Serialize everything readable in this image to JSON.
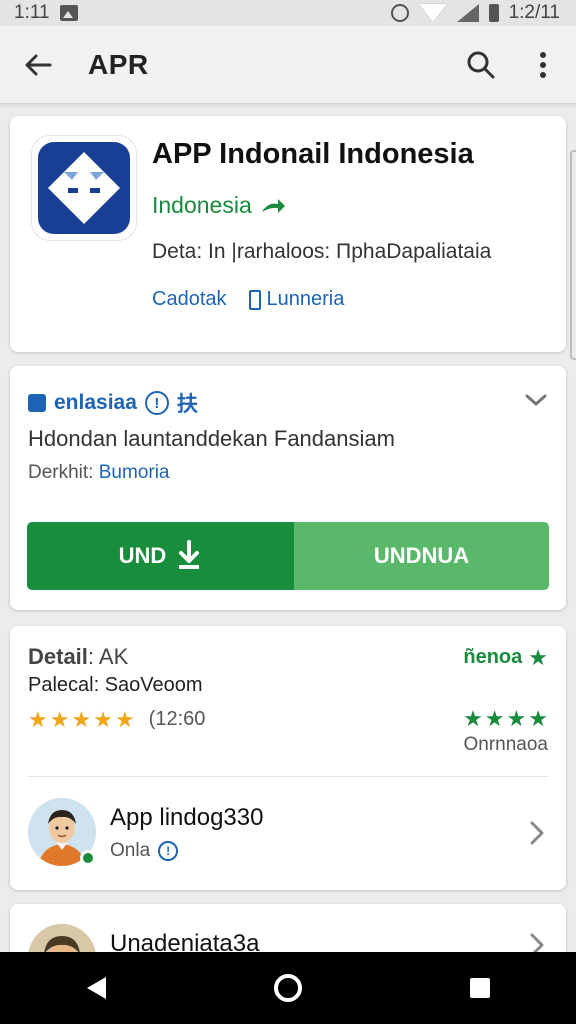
{
  "status_bar": {
    "time_left": "1:11",
    "time_right": "1:2/11"
  },
  "app_bar": {
    "title": "APR"
  },
  "app_header": {
    "name": "APP Indonail Indonesia",
    "country": "Indonesia",
    "detail": "Deta: In |rarhaloos: ΠphaDapaliataia",
    "link_1": "Cadotak",
    "link_2": "Lunneria"
  },
  "install_card": {
    "heading": "enlasiaa",
    "heading_extra": "扶",
    "info_symbol": "!",
    "description": "Hdondan launtanddekan Fandansiam",
    "developer_label": "Derkhit:",
    "developer_value": "Bumoria",
    "install_label": "UND",
    "open_label": "UNDNUA"
  },
  "rating_card": {
    "detail_label": "Detail",
    "detail_value": ": AK",
    "publisher_label": "Palecal:",
    "publisher_value": "SaoVeoom",
    "rating_stars": 5,
    "rating_count": "(12:60",
    "right_label": "ñenoa",
    "right_stars": 4,
    "right_caption": "Onrnnaoa"
  },
  "review": {
    "title": "App lindog330",
    "subtitle": "Onla",
    "info_symbol": "!"
  },
  "next_review": {
    "title": "Unadeniata3a"
  },
  "colors": {
    "accent_blue": "#1e64b4",
    "install_green": "#188d3c",
    "open_green": "#59b86a",
    "star_gold": "#f2a61a"
  },
  "icons": {
    "back": "arrow-left-icon",
    "search": "search-icon",
    "more": "more-vert-icon",
    "expand": "chevron-down-icon",
    "forward": "chevron-right-icon",
    "download": "download-icon",
    "nav_back": "triangle-back-icon",
    "nav_home": "circle-home-icon",
    "nav_recents": "square-recents-icon"
  }
}
